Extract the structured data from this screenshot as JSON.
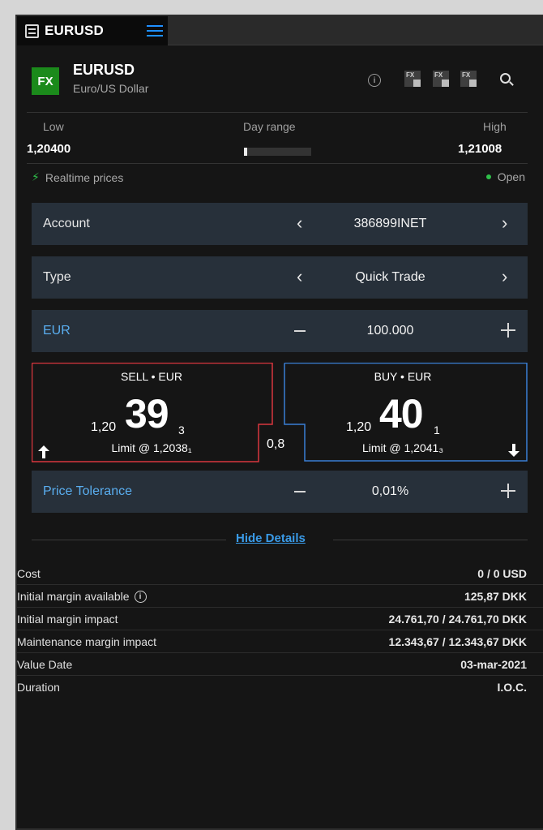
{
  "tab": {
    "title": "EURUSD"
  },
  "instrument": {
    "badge": "FX",
    "symbol": "EURUSD",
    "description": "Euro/US Dollar",
    "header_icons": [
      "info-icon",
      "fx-forward-icon",
      "fx-swap-icon",
      "fx-options-icon",
      "search-icon"
    ]
  },
  "day_range": {
    "low_label": "Low",
    "range_label": "Day range",
    "high_label": "High",
    "low_value": "1,20400",
    "high_value": "1,21008",
    "position_fraction": 0.05
  },
  "status": {
    "realtime": "Realtime prices",
    "market": "Open"
  },
  "account": {
    "label": "Account",
    "value": "386899INET"
  },
  "type": {
    "label": "Type",
    "value": "Quick Trade"
  },
  "amount": {
    "label": "EUR",
    "value": "100.000"
  },
  "sell": {
    "header": "SELL • EUR",
    "prefix": "1,20",
    "big": "39",
    "pip": "3",
    "limit": "Limit @ 1,2038₁",
    "color": "#d9363e"
  },
  "buy": {
    "header": "BUY • EUR",
    "prefix": "1,20",
    "big": "40",
    "pip": "1",
    "limit": "Limit @ 1,2041₃",
    "color": "#3a7fd5"
  },
  "spread": "0,8",
  "tolerance": {
    "label": "Price Tolerance",
    "value": "0,01%"
  },
  "details_toggle": "Hide Details",
  "details": [
    {
      "label": "Cost",
      "value": "0 / 0 USD",
      "info": false
    },
    {
      "label": "Initial margin available",
      "value": "125,87 DKK",
      "info": true
    },
    {
      "label": "Initial margin impact",
      "value": "24.761,70 / 24.761,70 DKK",
      "info": false
    },
    {
      "label": "Maintenance margin impact",
      "value": "12.343,67 / 12.343,67 DKK",
      "info": false
    },
    {
      "label": "Value Date",
      "value": "03-mar-2021",
      "info": false
    },
    {
      "label": "Duration",
      "value": "I.O.C.",
      "info": false
    }
  ],
  "colors": {
    "accent": "#3a9be8",
    "positive": "#2fbf4a",
    "row_bg": "#27303a"
  }
}
